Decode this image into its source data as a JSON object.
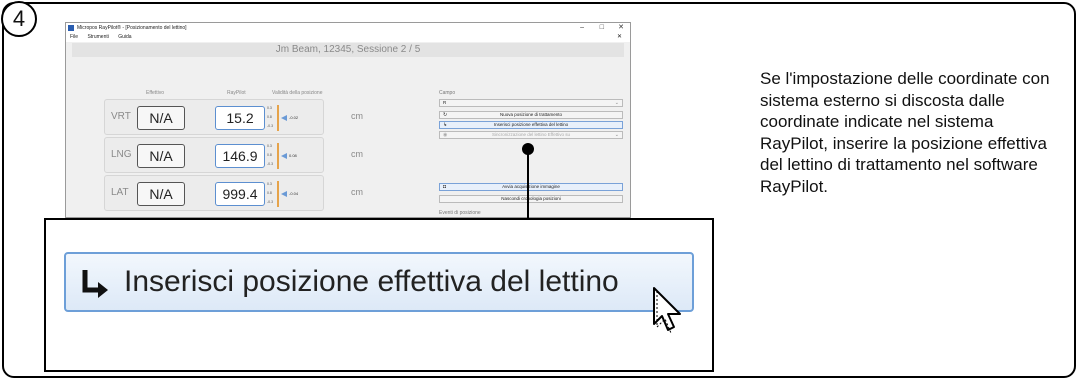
{
  "step": "4",
  "window": {
    "title": "Micropos RayPilot® - [Posizionamento del lettino]",
    "menu": [
      "File",
      "Strumenti",
      "Guida"
    ],
    "session": "Jm Beam, 12345, Sessione 2 / 5"
  },
  "columns": {
    "effettivo": "Effettivo",
    "raypilot": "RayPilot",
    "validita": "Validità della posizione"
  },
  "rows": [
    {
      "axis": "VRT",
      "effettivo": "N/A",
      "raypilot": "15.2",
      "scale": [
        "0.3",
        "0.8",
        "-0.3"
      ],
      "delta": "-0.02",
      "unit": "cm"
    },
    {
      "axis": "LNG",
      "effettivo": "N/A",
      "raypilot": "146.9",
      "scale": [
        "0.3",
        "0.8",
        "-0.3"
      ],
      "delta": "0.08",
      "unit": "cm"
    },
    {
      "axis": "LAT",
      "effettivo": "N/A",
      "raypilot": "999.4",
      "scale": [
        "0.3",
        "0.8",
        "-0.3"
      ],
      "delta": "-0.04",
      "unit": "cm"
    }
  ],
  "panel": {
    "campo_label": "Campo",
    "campo_value": "R",
    "btn_new": "Nuova posizione di trattamento",
    "btn_insert": "Inserisci posizione effettiva del lettino",
    "btn_disabled": "Sincronizzazione del lettino Effettivo su",
    "btn_acq": "Avvia acquisizione immagine",
    "btn_hide": "Nascondi cronologia posizioni",
    "eventi_label": "Eventi di posizione"
  },
  "zoom_label": "Inserisci posizione effettiva del lettino",
  "description": "Se l'impostazione delle coordinate con sistema esterno si discosta dalle coordinate indicate nel sistema RayPilot, inserire la posizione effettiva del lettino di trattamento nel software RayPilot.",
  "colors": {
    "accent": "#6d9fd8",
    "gauge": "#e6a34a"
  }
}
